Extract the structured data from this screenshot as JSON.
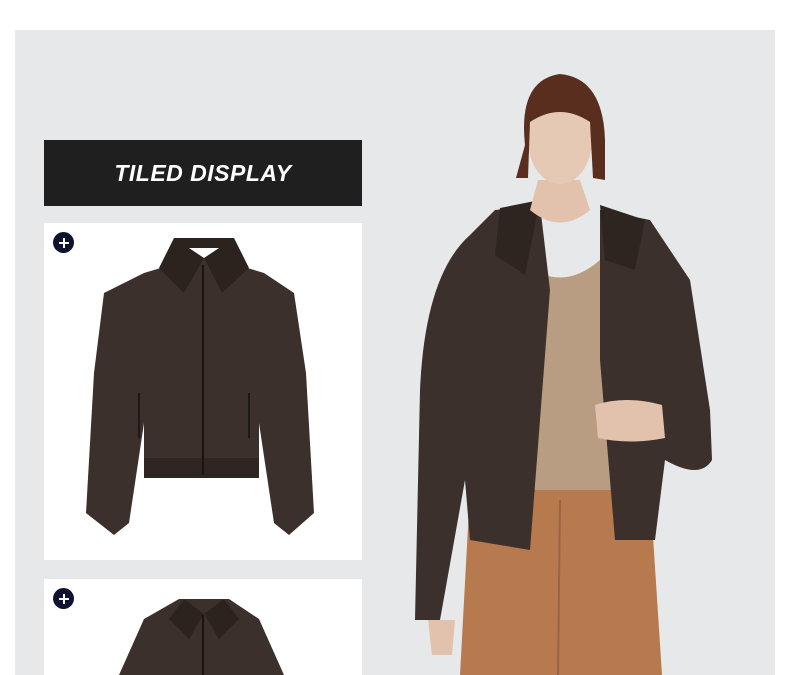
{
  "banner": {
    "title": "TILED DISPLAY"
  },
  "tiles": [
    {
      "icon": "plus-circle-icon",
      "image": "leather-jacket-front"
    },
    {
      "icon": "plus-circle-icon",
      "image": "leather-jacket-collar"
    }
  ],
  "model": {
    "image": "model-wearing-jacket"
  },
  "colors": {
    "stage_bg": "#e7e8ea",
    "banner_bg": "#1f1f1f",
    "jacket": "#3b302b",
    "top": "#b89d82",
    "trousers": "#b77a4e",
    "plus_badge": "#0e1430"
  }
}
